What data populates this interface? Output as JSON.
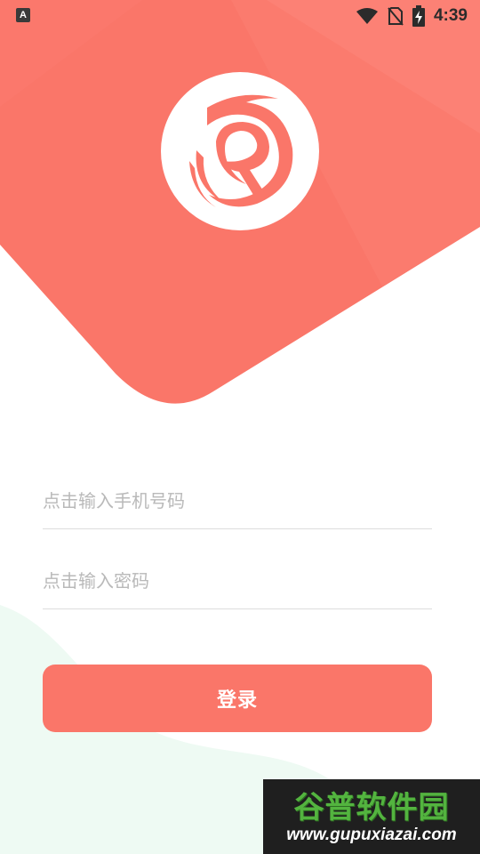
{
  "status_bar": {
    "app_icon_letter": "A",
    "time": "4:39",
    "icons": [
      "wifi-icon",
      "no-sim-icon",
      "battery-charging-icon"
    ]
  },
  "header": {
    "logo_icon": "app-logo-icon"
  },
  "login_form": {
    "phone_placeholder": "点击输入手机号码",
    "password_placeholder": "点击输入密码",
    "phone_value": "",
    "password_value": "",
    "login_label": "登录"
  },
  "watermark": {
    "title": "谷普软件园",
    "url": "www.gupuxiazai.com"
  },
  "colors": {
    "accent": "#fa7669",
    "header_bg": "#fa7669",
    "mint_bg": "#eefaf3",
    "watermark_green": "#53b43f"
  }
}
